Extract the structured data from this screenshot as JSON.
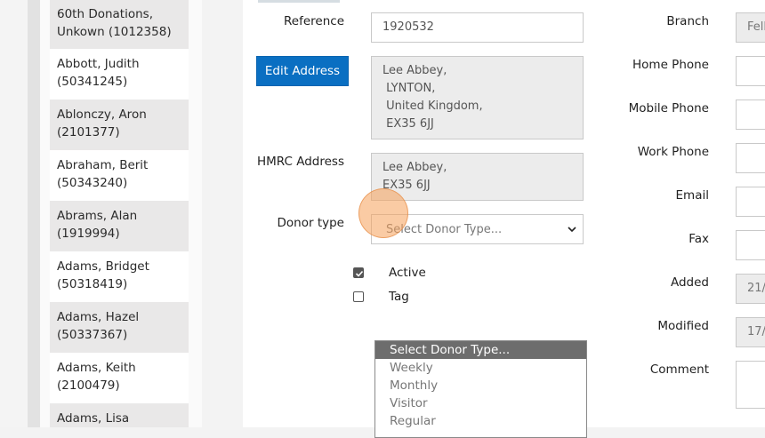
{
  "donor_list": [
    {
      "label": "60th Donations,\nUnkown (1012358)"
    },
    {
      "label": "Abbott, Judith\n(50341245)"
    },
    {
      "label": "Ablonczy, Aron\n(2101377)"
    },
    {
      "label": "Abraham, Berit\n(50343240)"
    },
    {
      "label": "Abrams, Alan\n(1919994)"
    },
    {
      "label": "Adams, Bridget\n(50318419)"
    },
    {
      "label": "Adams, Hazel\n(50337367)"
    },
    {
      "label": "Adams, Keith\n(2100479)"
    },
    {
      "label": "Adams, Lisa\n"
    }
  ],
  "form": {
    "reference_label": "Reference",
    "reference_value": "1920532",
    "edit_address_label": "Edit Address",
    "address_lines": "Lee Abbey,\n LYNTON,\n United Kingdom,\n EX35 6JJ",
    "hmrc_label": "HMRC Address",
    "hmrc_lines": "Lee Abbey,\nEX35 6JJ",
    "donor_type_label": "Donor type",
    "donor_type_value": "Select Donor Type...",
    "active_label": "Active",
    "active_checked": true,
    "tag_label": "Tag",
    "tag_checked": false,
    "donor_type_options": [
      "Select Donor Type...",
      "Weekly",
      "Monthly",
      "Visitor",
      "Regular"
    ]
  },
  "right": {
    "branch_label": "Branch",
    "branch_value": "Fell",
    "home_phone_label": "Home Phone",
    "mobile_phone_label": "Mobile Phone",
    "work_phone_label": "Work Phone",
    "email_label": "Email",
    "fax_label": "Fax",
    "added_label": "Added",
    "added_value": "21/",
    "modified_label": "Modified",
    "modified_value": "17/",
    "comment_label": "Comment"
  },
  "colors": {
    "accent": "#0a6fc2",
    "selected_option": "#6d6d6d",
    "cursor": "#f5a05a"
  }
}
